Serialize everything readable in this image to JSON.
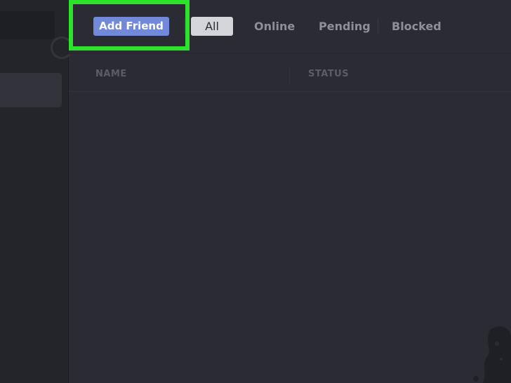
{
  "header": {
    "add_friend_label": "Add Friend",
    "tabs": [
      {
        "label": "All"
      },
      {
        "label": "Online"
      },
      {
        "label": "Pending"
      },
      {
        "label": "Blocked"
      }
    ]
  },
  "table": {
    "columns": [
      "NAME",
      "STATUS"
    ]
  },
  "colors": {
    "accent": "#7289da",
    "highlight": "#2de22a",
    "background": "#2b2b34",
    "sidebar": "#24242b"
  }
}
